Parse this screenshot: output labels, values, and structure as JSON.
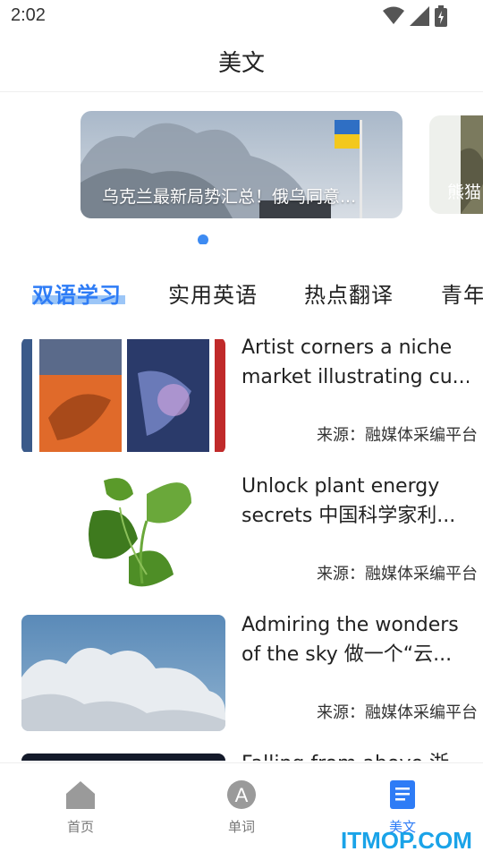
{
  "status_bar": {
    "time": "2:02",
    "icons": [
      "wifi-icon",
      "signal-icon",
      "battery-icon"
    ]
  },
  "header": {
    "title": "美文"
  },
  "banner": {
    "items": [
      {
        "caption": "乌克兰最新局势汇总！俄乌同意..."
      },
      {
        "caption": "熊猫"
      }
    ],
    "active_index": 0
  },
  "tabs": [
    {
      "label": "双语学习",
      "active": true
    },
    {
      "label": "实用英语",
      "active": false
    },
    {
      "label": "热点翻译",
      "active": false
    },
    {
      "label": "青年",
      "active": false
    }
  ],
  "articles": [
    {
      "title_line1": "Artist corners a niche",
      "title_line2": "market illustrating cu...",
      "source": "来源：融媒体采编平台",
      "thumb": "journal-covers"
    },
    {
      "title_line1": "Unlock plant energy",
      "title_line2": "secrets 中国科学家利...",
      "source": "来源：融媒体采编平台",
      "thumb": "spinach-leaves"
    },
    {
      "title_line1": "Admiring the wonders",
      "title_line2": "of the sky 做一个“云...",
      "source": "来源：融媒体采编平台",
      "thumb": "clouds-sky"
    },
    {
      "title_line1": "Falling from above 浙",
      "title_line2": "",
      "source": "",
      "thumb": "night-sky"
    }
  ],
  "bottom_nav": [
    {
      "label": "首页",
      "icon": "home-icon",
      "active": false
    },
    {
      "label": "单词",
      "icon": "letter-a-icon",
      "active": false
    },
    {
      "label": "美文",
      "icon": "document-icon",
      "active": true
    }
  ],
  "watermark": "ITMOP.COM",
  "colors": {
    "accent": "#2e7cf6",
    "tab_highlight": "#9cc6f7",
    "dot": "#3d8bf2",
    "nav_inactive": "#9a9a9a",
    "watermark": "#1aa3e8"
  }
}
